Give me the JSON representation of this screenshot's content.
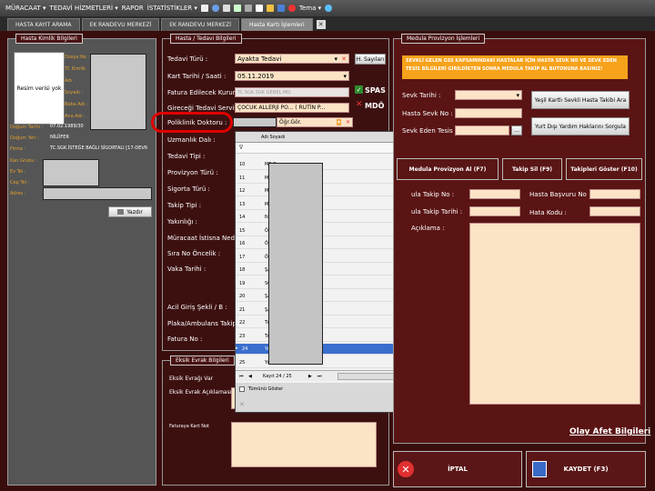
{
  "menu": {
    "items": [
      "MÜRACAAT ▾",
      "TEDAVİ HİZMETLERİ ▾",
      "RAPOR",
      "İSTATİSTİKLER ▾"
    ],
    "tema": "Tema ▾"
  },
  "tabs": [
    "HASTA KAYIT ARAMA",
    "EK RANDEVU MERKEZİ",
    "EK RANDEVU MERKEZİ",
    "Hasta Kartı İşlemleri"
  ],
  "tab_close": "✕",
  "kimlik": {
    "title": "Hasta Kimlik Bilgileri",
    "photo_text": "Resim verisi yok",
    "olabels": [
      "Dosya No :",
      "TC Kimlik",
      "Adı :",
      "Soyadı :",
      "Baba Adı :",
      "Ana Adı :"
    ],
    "dogum_tarihi_label": "Doğum Tarihi :",
    "dogum_tarihi": "07.02.1989/30",
    "dogum_yeri_label": "Doğum Yeri :",
    "dogum_yeri": "NİLÜFER",
    "firma_label": "Firma :",
    "firma": "TC.SGK.İSTEĞE BAĞLI SİGORTALI [17-DEVR",
    "kan_grubu_label": "Kan Grubu :",
    "ev_tel_label": "Ev Tel :",
    "cep_tel_label": "Cep Tel :",
    "adres_label": "Adres :",
    "yazdir": "Yazdır"
  },
  "tedavi": {
    "title": "Hasta / Tedavi Bilgileri",
    "tedavi_turu_label": "Tedavi Türü :",
    "tedavi_turu": "Ayakta Tedavi",
    "kart_tarihi_label": "Kart Tarihi / Saati :",
    "kart_tarihi": "05.11.2019",
    "fatura_label": "Fatura Edilecek Kurum :",
    "fatura": "TC.SGK.SGK GENEL MD.",
    "servis_label": "Gireceği Tedavi Servisi",
    "servis": "ÇOCUK ALLERJİ PO... ( RUTİN P...",
    "poliklinik_label": "Poliklinik Doktoru :",
    "poliklinik_value": "Öğr.Gör.",
    "uzmanlik_label": "Uzmanlık Dalı :",
    "tedavi_tipi_label": "Tedavi Tipi :",
    "provizyon_label": "Provizyon Türü :",
    "sigorta_label": "Sigorta Türü :",
    "takip_label": "Takip Tipi :",
    "yakinligi_label": "Yakınlığı :",
    "muracaat_label": "Müracaat İstisna Nedeni",
    "sira_label": "Sıra No Öncelik :",
    "vaka_label": "Vaka Tarihi :",
    "acil_label": "Acil Giriş Şekli / B :",
    "plaka_label": "Plaka/Ambulans Takip",
    "fatura_no_label": "Fatura No :",
    "h_sayilari": "H. Sayıları",
    "spas": "SPAS",
    "mdo": "MDÖ",
    "x": "✕",
    "drop": "▾"
  },
  "dropdown": {
    "header": "Adı Soyadı",
    "filter": "∇",
    "rows": [
      {
        "num": "10",
        "name": "ME                         Dr."
      },
      {
        "num": "11",
        "name": "ME                         Dr."
      },
      {
        "num": "12",
        "name": "MU                         .Dr."
      },
      {
        "num": "13",
        "name": "MU                         STAFAOĞLU Prof.Dr."
      },
      {
        "num": "14",
        "name": "NİL"
      },
      {
        "num": "15",
        "name": "ÖG"
      },
      {
        "num": "16",
        "name": "ÖM                         .Dr."
      },
      {
        "num": "17",
        "name": "ÖZ                         Dr."
      },
      {
        "num": "18",
        "name": "ŞA                         EKİN Prof.Dr."
      },
      {
        "num": "19",
        "name": "SO"
      },
      {
        "num": "20",
        "name": "ŞA"
      },
      {
        "num": "21",
        "name": "ŞA"
      },
      {
        "num": "22",
        "name": "TA                         yesi"
      },
      {
        "num": "23",
        "name": "TA                         Prof.Dr."
      },
      {
        "num": "24",
        "name": "YA"
      },
      {
        "num": "25",
        "name": "YA                         N Öğr.Gör."
      }
    ],
    "selected_marker": "▸",
    "pager": "Kayıt 24 / 25",
    "tumunu_goster": "Tümünü Göster"
  },
  "eksik": {
    "title": "Eksik Evrak Bilgileri",
    "evrak_var": "Eksik Evrağı Var",
    "evrak_aciklama": "Eksik Evrak Açıklaması",
    "fatura_kart_not": "Faturaya Kart Not"
  },
  "medula": {
    "title": "Medula Provizyon İşlemleri",
    "warning": "SEVKLİ GELEN GSS KAPSAMINDAKİ HASTALAR İÇİN HASTA SEVK NO VE SEVK EDEN TESİS BİLGİLERİ GİRİLDİKTEN SONRA MEDULA TAKİP AL BUTONUNA BASINIZ!",
    "sevk_tarihi": "Sevk Tarihi :",
    "hasta_sevk_no": "Hasta Sevk No :",
    "sevk_eden_tesis": "Sevk Eden Tesis :",
    "yesil_kart_btn": "Yeşil Kartlı Sevkli Hasta Takibi Ara",
    "yurt_disi_btn": "Yurt Dışı Yardım Haklarını Sorgula",
    "provizyon_al": "Medula Provizyon Al (F7)",
    "takip_sil": "Takip Sil (F9)",
    "takipleri_goster": "Takipleri Göster (F10)",
    "takip_no": "ula Takip No :",
    "takip_tarihi": "ula Takip Tarihi :",
    "hasta_basvuru_no": "Hasta Başvuru No",
    "hata_kodu": "Hata Kodu :",
    "aciklama": "Açıklama :",
    "olay_afet": "Olay Afet Bilgileri"
  },
  "bottom": {
    "iptal": "İPTAL",
    "kaydet": "KAYDET (F3)"
  }
}
